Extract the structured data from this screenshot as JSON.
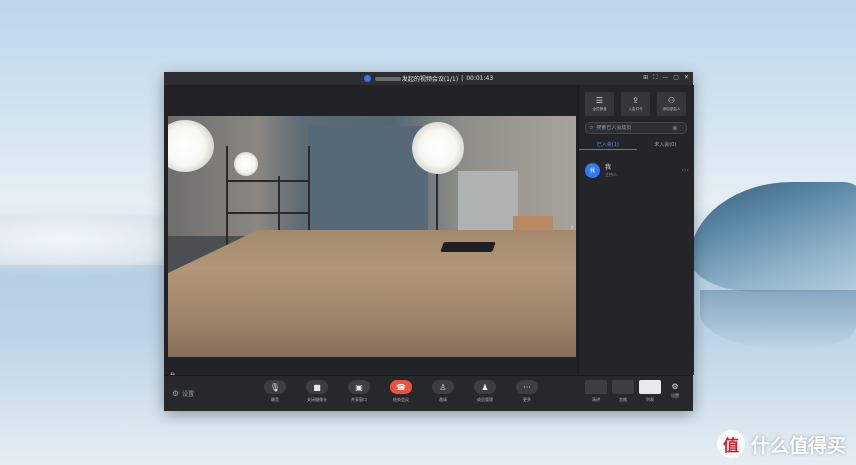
{
  "window": {
    "title": "发起的视频会议(1/1)",
    "separator": "|",
    "timer": "00:01:43",
    "controls": [
      "⊞",
      "⛶",
      "—",
      "▢",
      "✕"
    ]
  },
  "video": {
    "participant_name": "我"
  },
  "toolbar": {
    "left_label": "设置",
    "buttons": [
      {
        "icon": "microphone-icon",
        "glyph": "🎙",
        "label": "静音"
      },
      {
        "icon": "video-camera-icon",
        "glyph": "■",
        "label": "关闭摄像头"
      },
      {
        "icon": "share-screen-icon",
        "glyph": "▣",
        "label": "共享窗口"
      },
      {
        "icon": "hang-up-icon",
        "glyph": "☎",
        "label": "结束会议"
      },
      {
        "icon": "invite-icon",
        "glyph": "♙",
        "label": "邀请"
      },
      {
        "icon": "members-icon",
        "glyph": "♟",
        "label": "成员管理"
      },
      {
        "icon": "more-icon",
        "glyph": "···",
        "label": "更多"
      }
    ],
    "layout_buttons": [
      {
        "icon": "layout-speaker-icon",
        "label": "演讲"
      },
      {
        "icon": "layout-grid-icon",
        "label": "宫格"
      },
      {
        "icon": "layout-list-icon",
        "label": "列表"
      }
    ],
    "settings_label": "设置",
    "accent_red": "#f0513a"
  },
  "panel": {
    "actions": [
      {
        "icon": "mute-all-icon",
        "glyph": "☰",
        "label": "全员静音"
      },
      {
        "icon": "share-link-icon",
        "glyph": "⇪",
        "label": "入会口令"
      },
      {
        "icon": "add-member-icon",
        "glyph": "⚇",
        "label": "添加参会人"
      }
    ],
    "search_placeholder": "搜索已入会成员",
    "tabs": [
      "已入会(1)",
      "未入会(0)"
    ],
    "members": [
      {
        "avatar_text": "我",
        "name": "我",
        "role": "主持人"
      }
    ],
    "accent_blue": "#2f7bf5"
  },
  "watermark": {
    "logo_text": "值",
    "text": "什么值得买"
  }
}
